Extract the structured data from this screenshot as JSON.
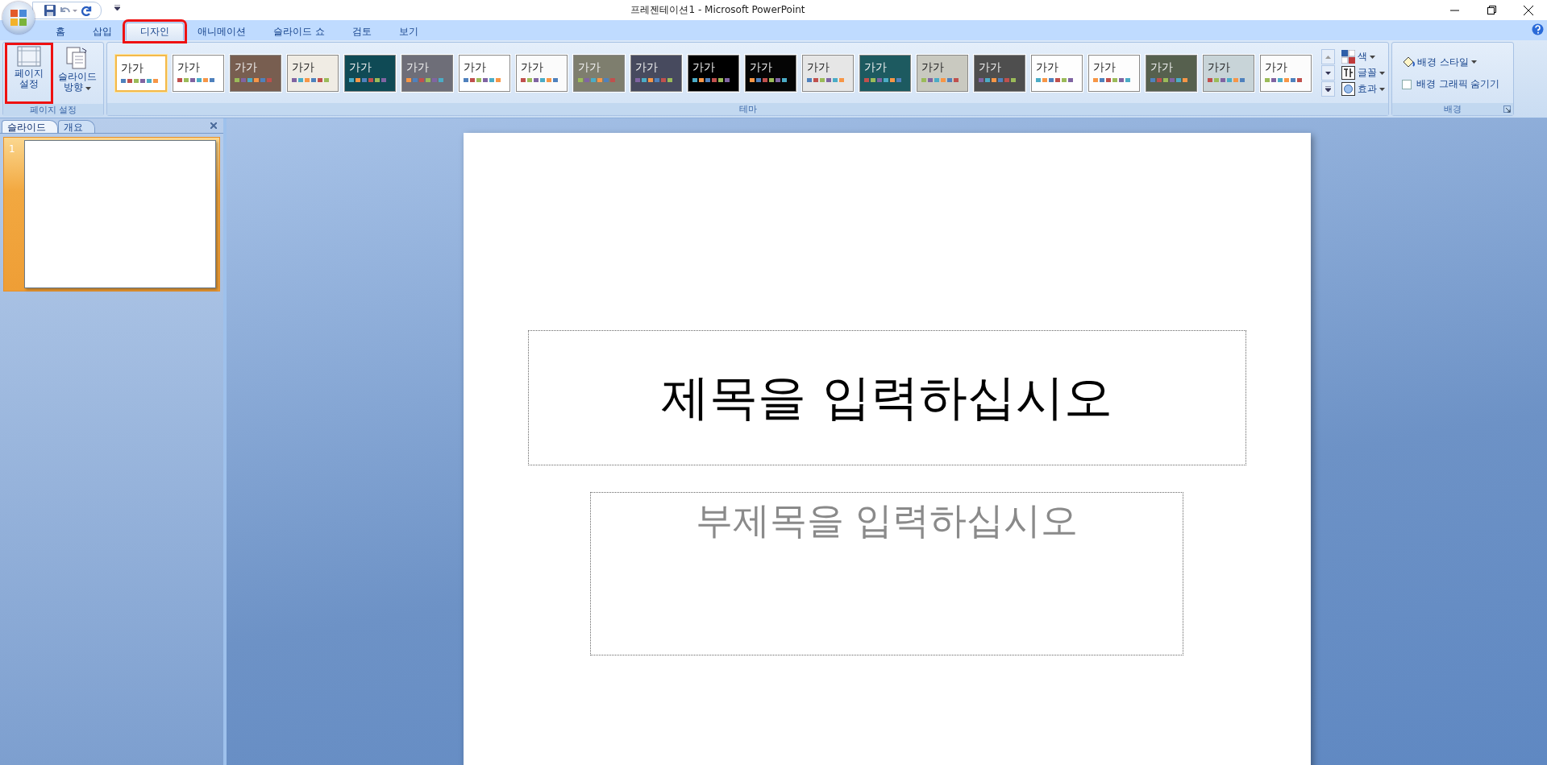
{
  "window": {
    "title": "프레젠테이션1 - Microsoft PowerPoint"
  },
  "tabs": [
    {
      "label": "홈",
      "selected": false,
      "highlighted": false
    },
    {
      "label": "삽입",
      "selected": false,
      "highlighted": false
    },
    {
      "label": "디자인",
      "selected": true,
      "highlighted": true
    },
    {
      "label": "애니메이션",
      "selected": false,
      "highlighted": false
    },
    {
      "label": "슬라이드 쇼",
      "selected": false,
      "highlighted": false
    },
    {
      "label": "검토",
      "selected": false,
      "highlighted": false
    },
    {
      "label": "보기",
      "selected": false,
      "highlighted": false
    }
  ],
  "page_setup_group": {
    "label": "페이지 설정",
    "buttons": [
      {
        "label": "페이지 설정",
        "kind": "page",
        "highlighted": true,
        "dropdown": false
      },
      {
        "label": "슬라이드 방향",
        "kind": "orientation",
        "highlighted": false,
        "dropdown": true
      }
    ]
  },
  "theme_group": {
    "label": "테마",
    "themes": [
      {
        "label": "가가",
        "color": "#ffffff",
        "selected": true
      },
      {
        "label": "가가",
        "color": "#ffffff",
        "selected": false
      },
      {
        "label": "가가",
        "color": "#785e50",
        "selected": false
      },
      {
        "label": "가가",
        "color": "#f0ece4",
        "selected": false
      },
      {
        "label": "가가",
        "color": "#0f4a55",
        "selected": false
      },
      {
        "label": "가가",
        "color": "#6e6e78",
        "selected": false
      },
      {
        "label": "가가",
        "color": "#ffffff",
        "selected": false
      },
      {
        "label": "가가",
        "color": "#fbfbfb",
        "selected": false
      },
      {
        "label": "가가",
        "color": "#7e7e6e",
        "selected": false
      },
      {
        "label": "가가",
        "color": "#474a5e",
        "selected": false
      },
      {
        "label": "가가",
        "color": "#000000",
        "selected": false
      },
      {
        "label": "가가",
        "color": "#050505",
        "selected": false
      },
      {
        "label": "가가",
        "color": "#e6e6e6",
        "selected": false
      },
      {
        "label": "가가",
        "color": "#1d5a60",
        "selected": false
      },
      {
        "label": "가가",
        "color": "#c9c9c0",
        "selected": false
      },
      {
        "label": "가가",
        "color": "#4e4e4e",
        "selected": false
      },
      {
        "label": "가가",
        "color": "#fefefe",
        "selected": false
      },
      {
        "label": "가가",
        "color": "#fdfdfd",
        "selected": false
      },
      {
        "label": "가가",
        "color": "#56604e",
        "selected": false
      },
      {
        "label": "가가",
        "color": "#c8d4d8",
        "selected": false
      },
      {
        "label": "가가",
        "color": "#fcfcfc",
        "selected": false
      }
    ],
    "options": [
      {
        "label": "색",
        "kind": "colors"
      },
      {
        "label": "글꼴",
        "kind": "fonts"
      },
      {
        "label": "효과",
        "kind": "effects"
      }
    ]
  },
  "background_group": {
    "label": "배경",
    "style_button": "배경 스타일",
    "hide_graphics": {
      "label": "배경 그래픽 숨기기",
      "checked": false
    }
  },
  "pane": {
    "tabs": [
      {
        "label": "슬라이드",
        "selected": true
      },
      {
        "label": "개요",
        "selected": false
      }
    ],
    "slides": [
      {
        "number": "1",
        "selected": true
      }
    ]
  },
  "slide": {
    "title": "제목을 입력하십시오",
    "subtitle": "부제목을 입력하십시오"
  }
}
